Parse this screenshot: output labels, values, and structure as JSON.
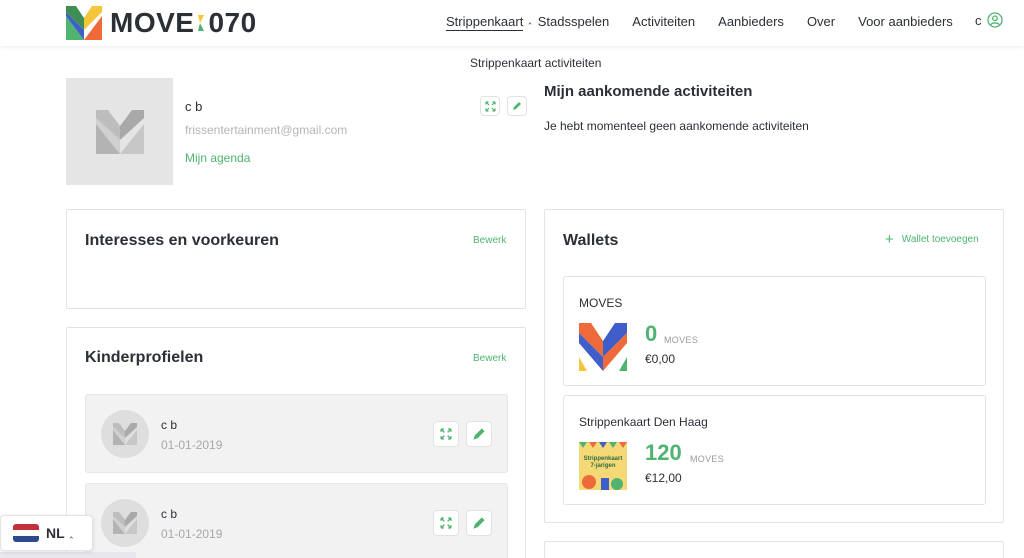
{
  "brand": {
    "name_left": "MOVE",
    "name_right": "070",
    "colors": {
      "green": "#4fb46f",
      "yellow": "#f3c53b",
      "orange": "#ef6a3a",
      "blue": "#3f5ec9",
      "dark": "#2b2f36"
    }
  },
  "nav": {
    "items": [
      {
        "label": "Strippenkaart",
        "active": true
      },
      {
        "label": "Stadsspelen"
      },
      {
        "label": "Activiteiten"
      },
      {
        "label": "Aanbieders"
      },
      {
        "label": "Over"
      },
      {
        "label": "Voor aanbieders"
      }
    ],
    "user_label": "c",
    "dropdown_item": "Strippenkaart activiteiten"
  },
  "profile": {
    "name": "c b",
    "email": "frissentertainment@gmail.com",
    "agenda_link": "Mijn agenda"
  },
  "upcoming": {
    "title": "Mijn aankomende activiteiten",
    "empty_text": "Je hebt momenteel geen aankomende activiteiten"
  },
  "interests": {
    "title": "Interesses en voorkeuren",
    "edit": "Bewerk"
  },
  "kids": {
    "title": "Kinderprofielen",
    "edit": "Bewerk",
    "items": [
      {
        "name": "c b",
        "date": "01-01-2019"
      },
      {
        "name": "c b",
        "date": "01-01-2019"
      }
    ]
  },
  "wallets": {
    "title": "Wallets",
    "add_label": "Wallet toevoegen",
    "items": [
      {
        "name": "MOVES",
        "amount": "0",
        "unit": "MOVES",
        "euro": "€0,00"
      },
      {
        "name": "Strippenkaart Den Haag",
        "amount": "120",
        "unit": "MOVES",
        "euro": "€12,00",
        "badge_text": "Strippenkaart 7-jarigen"
      }
    ]
  },
  "language": {
    "label": "NL"
  }
}
